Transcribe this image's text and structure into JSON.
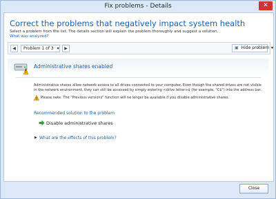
{
  "window": {
    "title": "Fix problems - Details",
    "close_glyph": "✕"
  },
  "header": {
    "headline": "Correct the problems that negatively impact system health",
    "subtitle": "Select a problem from the list. The details section will explain the problem thoroughly and suggest a solution.",
    "analyzed_link": "What was analyzed?"
  },
  "navigation": {
    "prev_glyph": "◀",
    "counter": "Problem 1 of 3",
    "dropdown_glyph": "▾",
    "next_glyph": "▶",
    "hide_label": "Hide problem",
    "hide_icon_glyph": "▣"
  },
  "problem": {
    "title": "Administrative shares enabled",
    "description": "Administrative shares allow network access to all drives connected to your computer. Even though the shared drives are not visible in the network environment, they can still be accessed by simply entering <drive letter>$ (for example, \"C$\") into the address bar.",
    "note": "Please note: The \"Previous versions\" function will no longer be available if you disable administrative shares.",
    "recommended_heading": "Recommended solution to the problem",
    "action_label": "Disable administrative shares",
    "effects_toggle": "What are the effects of this problem?",
    "effects_glyph": "▶"
  },
  "footer": {
    "close_label": "Close"
  },
  "colors": {
    "accent": "#1f5fa8",
    "link": "#1565c0",
    "warning": "#f2b705",
    "action_arrow": "#2e9e3a"
  }
}
